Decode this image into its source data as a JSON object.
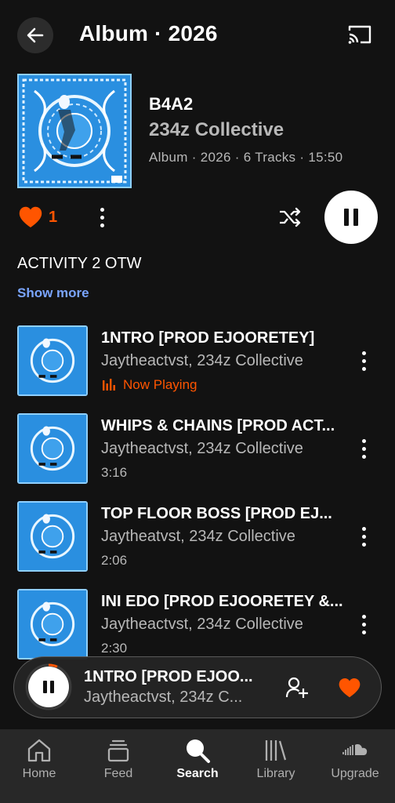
{
  "header": {
    "title": "Album · 2026"
  },
  "album": {
    "name": "B4A2",
    "artist": "234z Collective",
    "meta": "Album · 2026 · 6 Tracks · 15:50",
    "like_count": "1",
    "description": "ACTIVITY 2 OTW",
    "show_more": "Show more"
  },
  "tracks": [
    {
      "title": "1NTRO [PROD EJOORETEY]",
      "artist": "Jaytheactvst, 234z Collective",
      "sub": "Now Playing"
    },
    {
      "title": "WHIPS & CHAINS [PROD ACT...",
      "artist": "Jaytheactvst, 234z Collective",
      "sub": "3:16"
    },
    {
      "title": "TOP FLOOR BOSS [PROD EJ...",
      "artist": "Jaytheatvst, 234z Collective",
      "sub": "2:06"
    },
    {
      "title": "INI EDO [PROD EJOORETEY &...",
      "artist": "Jaytheactvst, 234z Collective",
      "sub": "2:30"
    }
  ],
  "mini_player": {
    "title": "1NTRO [PROD EJOO...",
    "artist": "Jaytheactvst, 234z C..."
  },
  "nav": {
    "items": [
      {
        "label": "Home",
        "icon": "home-icon"
      },
      {
        "label": "Feed",
        "icon": "feed-icon"
      },
      {
        "label": "Search",
        "icon": "search-icon"
      },
      {
        "label": "Library",
        "icon": "library-icon"
      },
      {
        "label": "Upgrade",
        "icon": "soundcloud-icon"
      }
    ],
    "active": "Search"
  },
  "colors": {
    "accent": "#ff5500",
    "link": "#7aa5ff",
    "background": "#121212",
    "art_blue": "#2a8fe0"
  }
}
